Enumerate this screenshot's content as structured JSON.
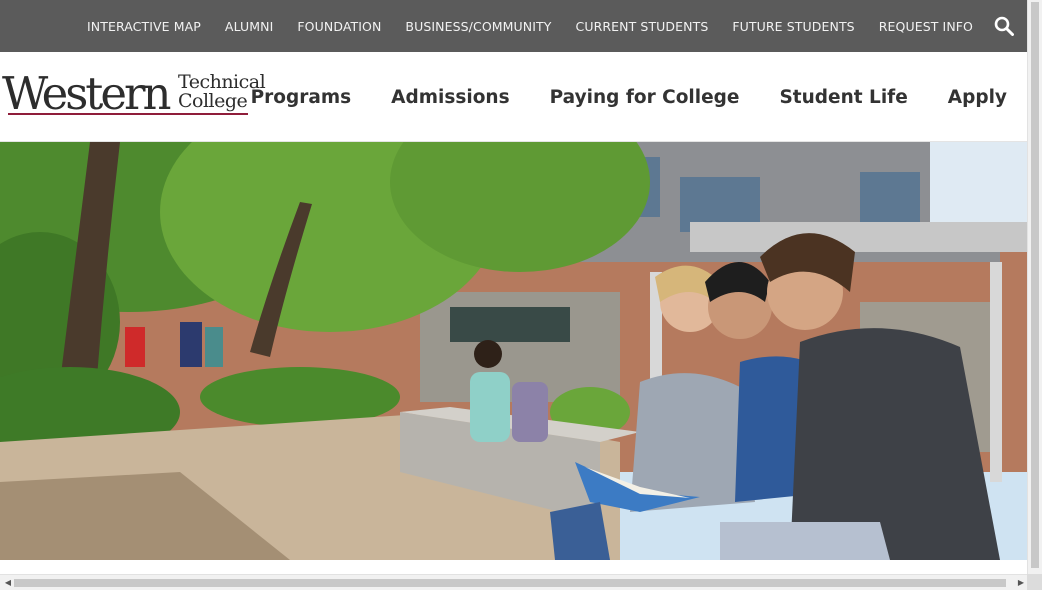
{
  "utility_nav": {
    "items": [
      {
        "id": "interactive-map",
        "label": "INTERACTIVE MAP"
      },
      {
        "id": "alumni",
        "label": "ALUMNI"
      },
      {
        "id": "foundation",
        "label": "FOUNDATION"
      },
      {
        "id": "business-community",
        "label": "BUSINESS/COMMUNITY"
      },
      {
        "id": "current-students",
        "label": "CURRENT STUDENTS"
      },
      {
        "id": "future-students",
        "label": "FUTURE STUDENTS"
      },
      {
        "id": "request-info",
        "label": "REQUEST INFO"
      }
    ],
    "search_icon": "search-icon"
  },
  "logo": {
    "word_large": "Western",
    "word_top": "Technical",
    "word_bottom": "College",
    "accent_color": "#8f1d3a"
  },
  "main_nav": {
    "items": [
      {
        "id": "programs",
        "label": "Programs"
      },
      {
        "id": "admissions",
        "label": "Admissions"
      },
      {
        "id": "paying-for-college",
        "label": "Paying for College"
      },
      {
        "id": "student-life",
        "label": "Student Life"
      },
      {
        "id": "apply",
        "label": "Apply"
      }
    ]
  },
  "hero": {
    "image_subject": "campus-courtyard-students-photo"
  },
  "colors": {
    "utility_bar": "#5b5b5b",
    "utility_text": "#f2f2f2",
    "nav_text": "#333333",
    "brand_maroon": "#8f1d3a"
  },
  "scrollbars": {
    "left_arrow_icon": "scroll-left-arrow-icon",
    "right_arrow_icon": "scroll-right-arrow-icon"
  }
}
